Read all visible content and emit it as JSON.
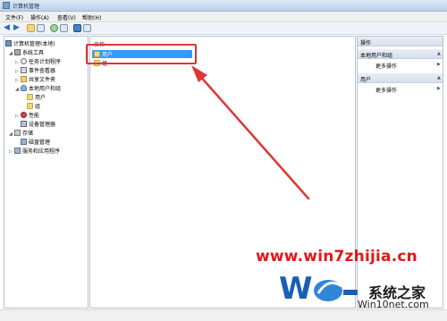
{
  "window": {
    "title": "计算机管理"
  },
  "menu": [
    "文件(F)",
    "操作(A)",
    "查看(V)",
    "帮助(H)"
  ],
  "tree": {
    "root": "计算机管理(本地)",
    "system_tools": "系统工具",
    "task_scheduler": "任务计划程序",
    "event_viewer": "事件查看器",
    "shared_folders": "共享文件夹",
    "local_users_groups": "本地用户和组",
    "users": "用户",
    "groups": "组",
    "performance": "性能",
    "device_manager": "设备管理器",
    "storage": "存储",
    "disk_management": "磁盘管理",
    "services_apps": "服务和应用程序"
  },
  "list": {
    "column_name": "名称",
    "items": [
      "用户",
      "组"
    ]
  },
  "actions": {
    "title": "操作",
    "section1": "本地用户和组",
    "section1_more": "更多操作",
    "section2": "用户",
    "section2_more": "更多操作"
  },
  "watermark": {
    "url": "www.win7zhijia.cn",
    "brand": "系统之家",
    "domain": "Win10net.com",
    "colors": {
      "url": "#e01818",
      "logo": "#1b5fb4"
    }
  },
  "colors": {
    "selection": "#3399ff",
    "annotation": "#e03535"
  }
}
